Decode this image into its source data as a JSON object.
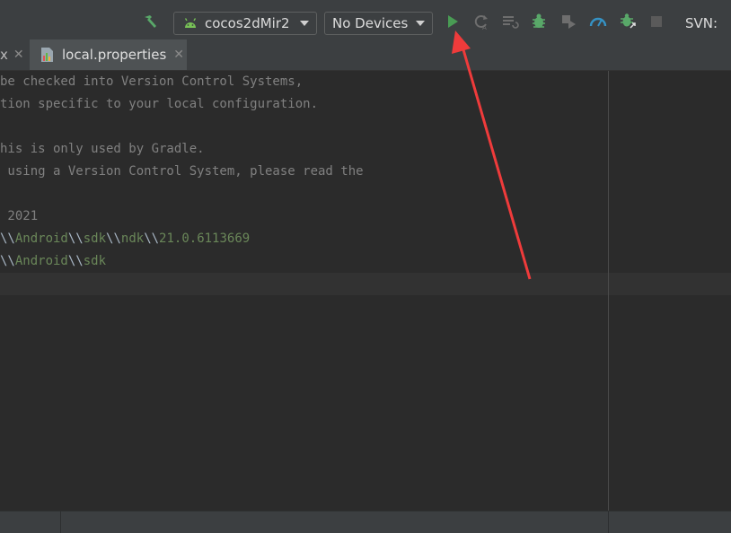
{
  "toolbar": {
    "config_combo": {
      "label": "cocos2dMir2",
      "icon": "android-icon"
    },
    "device_combo": {
      "label": "No Devices"
    },
    "svn_label": "SVN:",
    "icons": [
      "build-hammer-icon",
      "run-icon",
      "apply-changes-icon",
      "apply-code-changes-icon",
      "debug-icon",
      "attach-debugger-icon",
      "profile-icon",
      "attach-debugger-process-icon",
      "stop-icon"
    ]
  },
  "tabs": {
    "previous_tab_fragment": "x",
    "active_tab": {
      "label": "local.properties",
      "icon": "properties-file-icon"
    }
  },
  "editor": {
    "lines": [
      "be checked into Version Control Systems,",
      "tion specific to your local configuration.",
      "",
      "his is only used by Gradle.",
      " using a Version Control System, please read the",
      "",
      " 2021"
    ],
    "ndk_line": {
      "s1": "\\\\",
      "p1": "Android",
      "s2": "\\\\",
      "p2": "sdk",
      "s3": "\\\\",
      "p3": "ndk",
      "s4": "\\\\",
      "p4": "21.0.6113669"
    },
    "sdk_line": {
      "s1": "\\\\",
      "p1": "Android",
      "s2": "\\\\",
      "p2": "sdk"
    }
  },
  "colors": {
    "editor_bg": "#2b2b2b",
    "toolbar_bg": "#3c3f41",
    "comment": "#808080",
    "string_value": "#6a8759",
    "run_green": "#499c54",
    "annotation_arrow": "#ef3b3b"
  }
}
